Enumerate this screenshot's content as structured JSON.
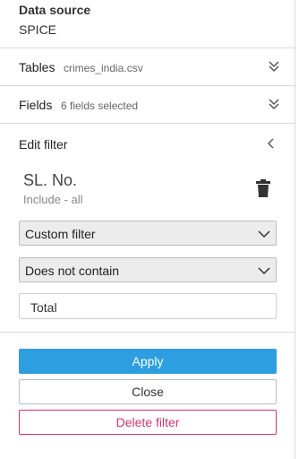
{
  "data_source": {
    "label": "Data source",
    "value": "SPICE"
  },
  "tables": {
    "label": "Tables",
    "value": "crimes_india.csv",
    "icon": "double-chevron-down-icon"
  },
  "fields": {
    "label": "Fields",
    "value": "6 fields selected",
    "icon": "double-chevron-down-icon"
  },
  "edit_filter": {
    "title": "Edit filter",
    "back_icon": "chevron-left-icon",
    "field_name": "SL. No.",
    "field_summary": "Include - all",
    "delete_icon": "trash-icon",
    "filter_type": {
      "selected": "Custom filter"
    },
    "condition": {
      "selected": "Does not contain"
    },
    "value_input": "Total"
  },
  "actions": {
    "apply": "Apply",
    "close": "Close",
    "delete": "Delete filter"
  },
  "colors": {
    "apply_bg": "#2d9fe0",
    "delete_border": "#d6336c",
    "select_bg": "#ececec"
  }
}
